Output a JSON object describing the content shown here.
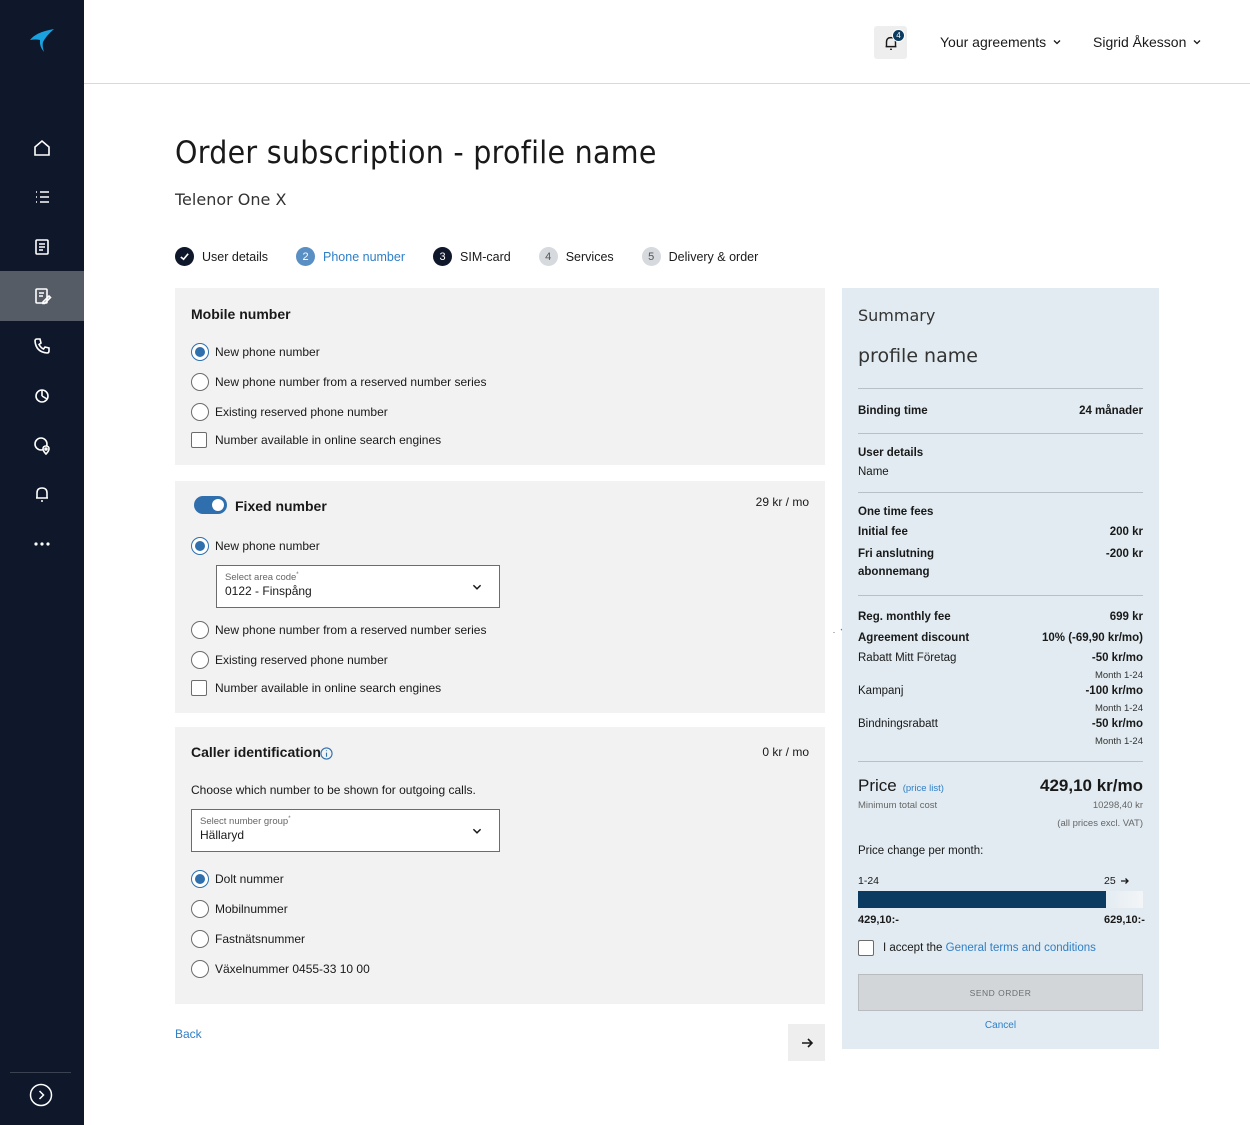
{
  "header": {
    "notification_count": "4",
    "agreements_label": "Your agreements",
    "user_name": "Sigrid Åkesson"
  },
  "sidebar": {
    "items": [
      {
        "name": "home-icon"
      },
      {
        "name": "list-icon"
      },
      {
        "name": "document-icon"
      },
      {
        "name": "order-icon",
        "active": true
      },
      {
        "name": "phone-icon"
      },
      {
        "name": "chart-icon"
      },
      {
        "name": "location-icon"
      },
      {
        "name": "bell-icon"
      },
      {
        "name": "more-icon"
      }
    ],
    "expand_icon": "chevron-right-icon"
  },
  "page": {
    "title": "Order subscription - profile name",
    "subtitle": "Telenor One X"
  },
  "steps": [
    {
      "num": "",
      "label": "User details",
      "state": "done"
    },
    {
      "num": "2",
      "label": "Phone number",
      "state": "current"
    },
    {
      "num": "3",
      "label": "SIM-card",
      "state": "dark"
    },
    {
      "num": "4",
      "label": "Services",
      "state": "todo"
    },
    {
      "num": "5",
      "label": "Delivery & order",
      "state": "todo"
    }
  ],
  "mobile": {
    "title": "Mobile number",
    "options": [
      "New phone number",
      "New phone number from a reserved number series",
      "Existing reserved phone number"
    ],
    "checkbox": "Number available in online search engines"
  },
  "fixed": {
    "title": "Fixed number",
    "price": "29 kr / mo",
    "new_number": "New phone number",
    "area_label": "Select area code",
    "area_value": "0122 - Finspång",
    "reserved": "New phone number from a reserved number series",
    "existing": "Existing reserved phone number",
    "checkbox": "Number available in online search engines"
  },
  "caller": {
    "title": "Caller identification",
    "price": "0 kr / mo",
    "description": "Choose which number to be shown for outgoing calls.",
    "group_label": "Select number group",
    "group_value": "Hällaryd",
    "options": [
      "Dolt nummer",
      "Mobilnummer",
      "Fastnätsnummer",
      "Växelnummer 0455-33 10 00"
    ]
  },
  "nav": {
    "back": "Back"
  },
  "summary": {
    "heading": "Summary",
    "profile": "profile name",
    "binding_label": "Binding time",
    "binding_value": "24 månader",
    "user_details_label": "User details",
    "user_details_value": "Name",
    "one_time_label": "One time fees",
    "initial_fee_label": "Initial fee",
    "initial_fee_value": "200 kr",
    "fri_label": "Fri anslutning",
    "fri_label2": "abonnemang",
    "fri_value": "-200 kr",
    "reg_label": "Reg. monthly fee",
    "reg_value": "699 kr",
    "agreement_label": "Agreement discount",
    "agreement_value": "10% (-69,90 kr/mo)",
    "rabatt_label": "Rabatt Mitt Företag",
    "rabatt_value": "-50 kr/mo",
    "rabatt_note": "Month 1-24",
    "kampanj_label": "Kampanj",
    "kampanj_value": "-100 kr/mo",
    "kampanj_note": "Month 1-24",
    "bindning_label": "Bindningsrabatt",
    "bindning_value": "-50 kr/mo",
    "bindning_note": "Month 1-24",
    "price_label": "Price",
    "price_list": "(price list)",
    "price_value": "429,10 kr/mo",
    "min_label": "Minimum total cost",
    "min_value": "10298,40 kr",
    "excl_vat": "(all prices excl. VAT)",
    "change_label": "Price change per month:",
    "period1": "1-24",
    "period2": "25",
    "price1": "429,10:-",
    "price2": "629,10:-",
    "period1_share": 0.87,
    "accept_prefix": "I accept the ",
    "accept_link": "General terms and conditions",
    "send": "SEND ORDER",
    "cancel": "Cancel"
  },
  "colors": {
    "sidebar_bg": "#0f172a",
    "accent": "#2f6fae",
    "link": "#2f7fc7",
    "summary_bg": "#e1ebf1",
    "bar": "#0b3b60"
  }
}
